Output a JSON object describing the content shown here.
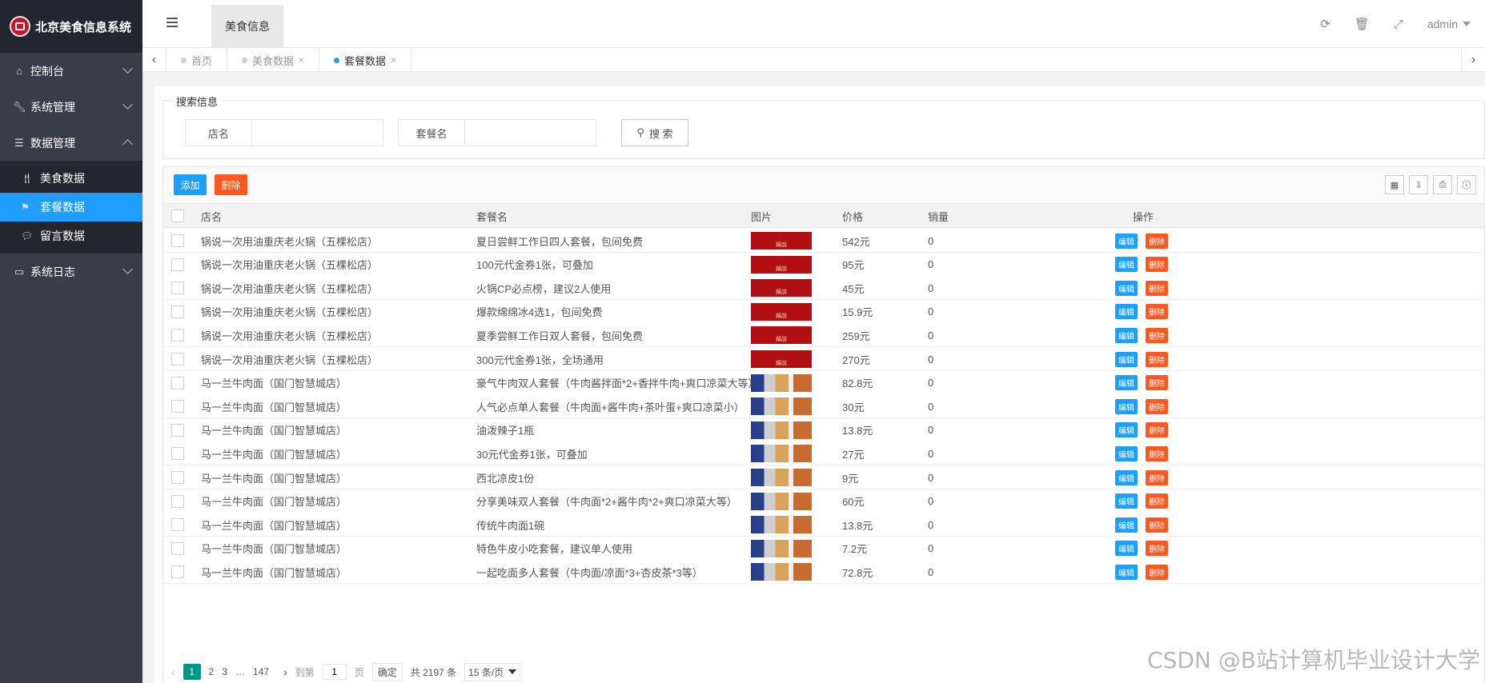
{
  "app": {
    "title": "北京美食信息系统"
  },
  "sidebar": {
    "items": [
      {
        "label": "控制台"
      },
      {
        "label": "系统管理"
      },
      {
        "label": "数据管理"
      },
      {
        "label": "系统日志"
      }
    ],
    "submenu": [
      {
        "label": "美食数据"
      },
      {
        "label": "套餐数据"
      },
      {
        "label": "留言数据"
      }
    ]
  },
  "header": {
    "tab": "美食信息",
    "user": "admin"
  },
  "tabs": [
    {
      "label": "首页"
    },
    {
      "label": "美食数据"
    },
    {
      "label": "套餐数据"
    }
  ],
  "search": {
    "legend": "搜索信息",
    "shop_label": "店名",
    "shop_value": "",
    "package_label": "套餐名",
    "package_value": "",
    "button": "搜 索"
  },
  "toolbar": {
    "add": "添加",
    "delete": "删除"
  },
  "table": {
    "columns": {
      "shop": "店名",
      "package": "套餐名",
      "image": "图片",
      "price": "价格",
      "sales": "销量",
      "ops": "操作"
    },
    "edit_label": "编辑",
    "delete_label": "删除",
    "rows": [
      {
        "shop": "锅说一次用油重庆老火锅（五棵松店）",
        "package": "夏日尝鲜工作日四人套餐，包间免费",
        "image": "red",
        "price": "542元",
        "sales": "0"
      },
      {
        "shop": "锅说一次用油重庆老火锅（五棵松店）",
        "package": "100元代金券1张，可叠加",
        "image": "red",
        "price": "95元",
        "sales": "0"
      },
      {
        "shop": "锅说一次用油重庆老火锅（五棵松店）",
        "package": "火锅CP必点榜，建议2人使用",
        "image": "red",
        "price": "45元",
        "sales": "0"
      },
      {
        "shop": "锅说一次用油重庆老火锅（五棵松店）",
        "package": "爆款绵绵冰4选1，包间免费",
        "image": "red",
        "price": "15.9元",
        "sales": "0"
      },
      {
        "shop": "锅说一次用油重庆老火锅（五棵松店）",
        "package": "夏季尝鲜工作日双人套餐，包间免费",
        "image": "red",
        "price": "259元",
        "sales": "0"
      },
      {
        "shop": "锅说一次用油重庆老火锅（五棵松店）",
        "package": "300元代金券1张，全场通用",
        "image": "red",
        "price": "270元",
        "sales": "0"
      },
      {
        "shop": "马一兰牛肉面（国门智慧城店）",
        "package": "豪气牛肉双人套餐（牛肉酱拌面*2+香拌牛肉+爽口凉菜大等）",
        "image": "photo",
        "price": "82.8元",
        "sales": "0"
      },
      {
        "shop": "马一兰牛肉面（国门智慧城店）",
        "package": "人气必点单人套餐（牛肉面+酱牛肉+茶叶蛋+爽口凉菜小）",
        "image": "photo",
        "price": "30元",
        "sales": "0"
      },
      {
        "shop": "马一兰牛肉面（国门智慧城店）",
        "package": "油泼辣子1瓶",
        "image": "photo",
        "price": "13.8元",
        "sales": "0"
      },
      {
        "shop": "马一兰牛肉面（国门智慧城店）",
        "package": "30元代金券1张，可叠加",
        "image": "photo",
        "price": "27元",
        "sales": "0"
      },
      {
        "shop": "马一兰牛肉面（国门智慧城店）",
        "package": "西北凉皮1份",
        "image": "photo",
        "price": "9元",
        "sales": "0"
      },
      {
        "shop": "马一兰牛肉面（国门智慧城店）",
        "package": "分享美味双人套餐（牛肉面*2+酱牛肉*2+爽口凉菜大等）",
        "image": "photo",
        "price": "60元",
        "sales": "0"
      },
      {
        "shop": "马一兰牛肉面（国门智慧城店）",
        "package": "传统牛肉面1碗",
        "image": "photo",
        "price": "13.8元",
        "sales": "0"
      },
      {
        "shop": "马一兰牛肉面（国门智慧城店）",
        "package": "特色牛皮小吃套餐，建议单人使用",
        "image": "photo",
        "price": "7.2元",
        "sales": "0"
      },
      {
        "shop": "马一兰牛肉面（国门智慧城店）",
        "package": "一起吃面多人套餐（牛肉面/凉面*3+杏皮茶*3等）",
        "image": "photo",
        "price": "72.8元",
        "sales": "0"
      }
    ]
  },
  "pager": {
    "prev": "‹",
    "pages": [
      "1",
      "2",
      "3",
      "…",
      "147"
    ],
    "next": "›",
    "goto_label": "到第",
    "goto_value": "1",
    "page_unit": "页",
    "confirm": "确定",
    "total": "共 2197 条",
    "per_page": "15 条/页"
  },
  "watermark": "CSDN @B站计算机毕业设计大学"
}
